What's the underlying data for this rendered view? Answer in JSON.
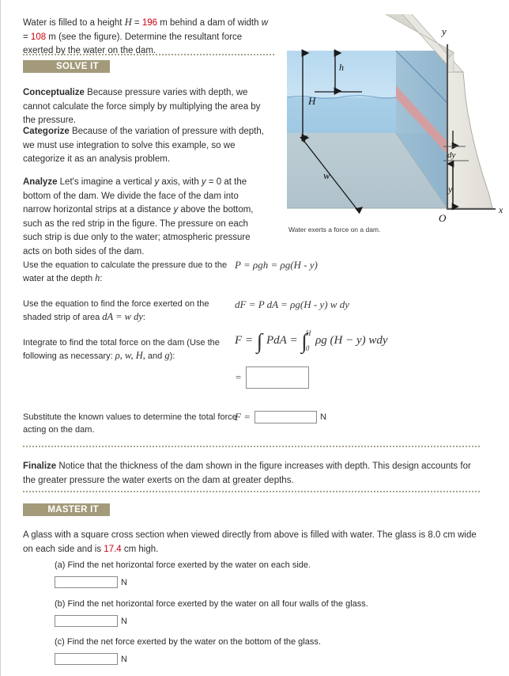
{
  "problem": {
    "intro_part1": "Water is filled to a height ",
    "intro_H_symbol": "H",
    "intro_eq1": " = ",
    "intro_H_value": "196",
    "intro_part2": " m behind a dam of width ",
    "intro_w_symbol": "w",
    "intro_eq2": " = ",
    "intro_w_value": "108",
    "intro_part3": " m (see the figure). Determine the resultant force exerted by the water on the dam."
  },
  "sections": {
    "solve_it_label": "SOLVE IT",
    "master_it_label": "MASTER IT"
  },
  "solve_it": {
    "conceptualize_head": "Conceptualize",
    "conceptualize_body": " Because pressure varies with depth, we cannot calculate the force simply by multiplying the area by the pressure.",
    "categorize_head": "Categorize",
    "categorize_body": " Because of the variation of pressure with depth, we must use integration to solve this example, so we categorize it as an analysis problem.",
    "analyze_head": "Analyze",
    "analyze_body_1": " Let's imagine a vertical ",
    "analyze_y1": "y",
    "analyze_body_2": " axis, with ",
    "analyze_y2": "y",
    "analyze_body_3": " = 0 at the bottom of the dam. We divide the face of the dam into narrow horizontal strips at a distance ",
    "analyze_y3": "y",
    "analyze_body_4": " above the bottom, such as the red strip in the figure. The pressure on each such strip is due only to the water; atmospheric pressure acts on both sides of the dam."
  },
  "steps": [
    {
      "prompt_1": "Use the equation to calculate the pressure due to the water at the depth ",
      "prompt_var": "h",
      "prompt_2": ":",
      "math": "P = ρgh = ρg(H - y)"
    },
    {
      "prompt_1": "Use the equation to find the force exerted on the shaded strip of area ",
      "prompt_var": "dA = w dy",
      "prompt_2": ":",
      "math": "dF = P dA = ρg(H - y) w dy"
    },
    {
      "prompt_1": "Integrate to find the total force on the dam (Use the following as necessary: ",
      "prompt_var": "ρ, w, H,",
      "prompt_and": " and ",
      "prompt_var2": "g",
      "prompt_2": "):",
      "integral": {
        "F": "F",
        "eq1": "=",
        "int1": "∫",
        "PdA": "PdA",
        "eq2": "=",
        "int2": "∫",
        "upper": "H",
        "lower": "0",
        "integrand": "ρg (H − y) wdy"
      },
      "answer_eq": "=",
      "answer_value": ""
    },
    {
      "prompt_1": "Substitute the known values to determine the total force acting on the dam.",
      "answer_label": "F =",
      "answer_value": "",
      "unit": "N"
    }
  ],
  "finalize": {
    "head": "Finalize",
    "body": " Notice that the thickness of the dam shown in the figure increases with depth. This design accounts for the greater pressure the water exerts on the dam at greater depths."
  },
  "master_it": {
    "intro_1": "A glass with a square cross section when viewed directly from above is filled with water. The glass is 8.0 cm wide on each side and is ",
    "intro_value": "17.4",
    "intro_2": " cm high.",
    "questions": [
      {
        "label": "(a) Find the net horizontal force exerted by the water on each side.",
        "value": "",
        "unit": "N"
      },
      {
        "label": "(b) Find the net horizontal force exerted by the water on all four walls of the glass.",
        "value": "",
        "unit": "N"
      },
      {
        "label": "(c) Find the net force exerted by the water on the bottom of the glass.",
        "value": "",
        "unit": "N"
      }
    ]
  },
  "figure": {
    "caption": "Water exerts a force on a dam.",
    "labels": {
      "h": "h",
      "H": "H",
      "w": "w",
      "y_axis": "y",
      "x_axis": "x",
      "origin": "O",
      "dy": "dy",
      "y_dist": "y"
    },
    "colors": {
      "water_top": "#b8d9ef",
      "water_bottom": "#a9cde5",
      "water_face": "#8fb6cd",
      "ground": "#b3c6ce",
      "dam_concrete": "#e4e4de",
      "dam_top": "#d6d6cf",
      "strip_red": "#d99b9b",
      "axis": "#5a5a5a"
    }
  }
}
